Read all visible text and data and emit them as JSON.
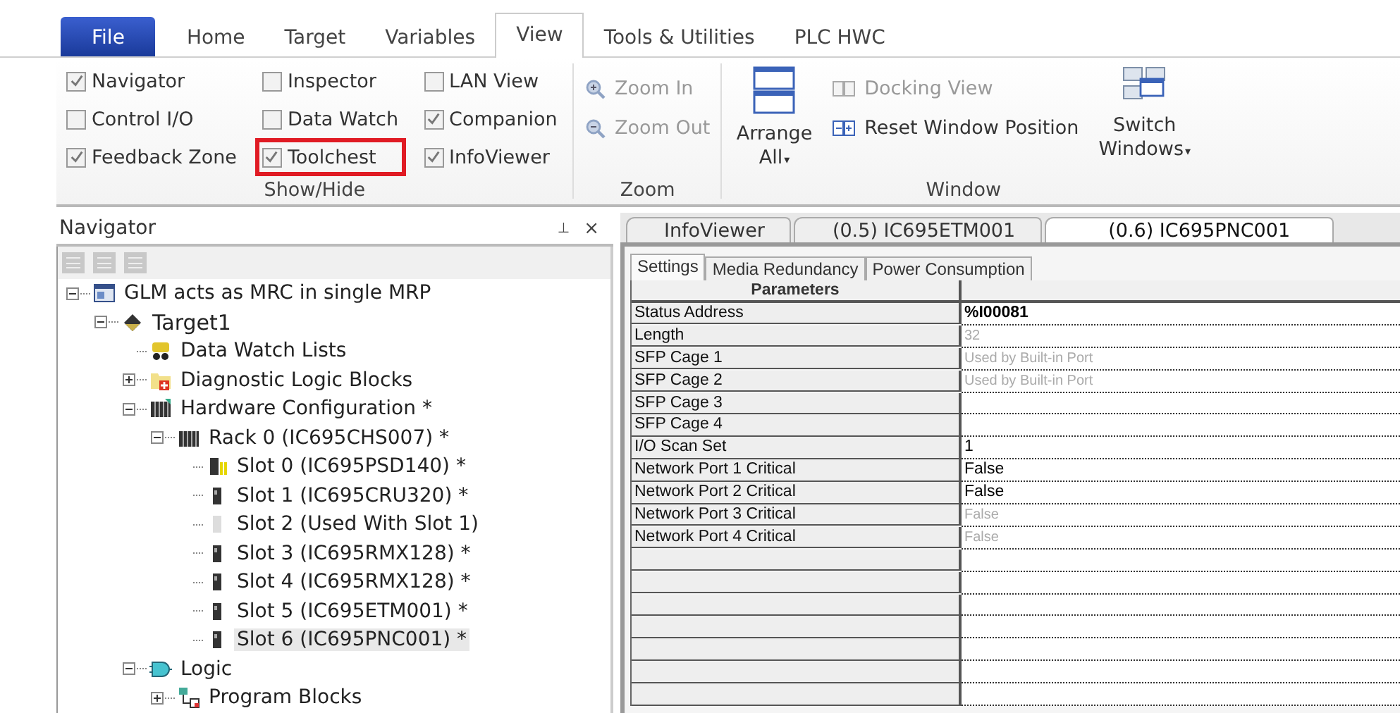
{
  "ribbon_tabs": [
    {
      "label": "File",
      "kind": "file",
      "selected": false
    },
    {
      "label": "Home",
      "kind": "tab",
      "selected": false
    },
    {
      "label": "Target",
      "kind": "tab",
      "selected": false
    },
    {
      "label": "Variables",
      "kind": "tab",
      "selected": false
    },
    {
      "label": "View",
      "kind": "tab",
      "selected": true
    },
    {
      "label": "Tools & Utilities",
      "kind": "tab",
      "selected": false
    },
    {
      "label": "PLC HWC",
      "kind": "tab",
      "selected": false
    }
  ],
  "show_hide": {
    "label": "Show/Hide",
    "columns": [
      [
        {
          "label": "Navigator",
          "checked": true,
          "highlighted": false
        },
        {
          "label": "Control I/O",
          "checked": false,
          "highlighted": false
        },
        {
          "label": "Feedback Zone",
          "checked": true,
          "highlighted": false
        }
      ],
      [
        {
          "label": "Inspector",
          "checked": false,
          "highlighted": false
        },
        {
          "label": "Data Watch",
          "checked": false,
          "highlighted": false
        },
        {
          "label": "Toolchest",
          "checked": true,
          "highlighted": true
        }
      ],
      [
        {
          "label": "LAN View",
          "checked": false,
          "highlighted": false
        },
        {
          "label": "Companion",
          "checked": true,
          "highlighted": false
        },
        {
          "label": "InfoViewer",
          "checked": true,
          "highlighted": false
        }
      ]
    ]
  },
  "zoom": {
    "label": "Zoom",
    "items": [
      {
        "label": "Zoom In",
        "kind": "zoom-in",
        "disabled": true
      },
      {
        "label": "Zoom Out",
        "kind": "zoom-out",
        "disabled": true
      }
    ]
  },
  "window_group": {
    "label": "Window",
    "arrange": {
      "line1": "Arrange",
      "line2": "All",
      "caret": "▾"
    },
    "items": [
      {
        "label": "Docking View",
        "kind": "docking",
        "disabled": true
      },
      {
        "label": "Reset Window Position",
        "kind": "reset",
        "disabled": false
      }
    ],
    "switch": {
      "line1": "Switch",
      "line2": "Windows",
      "caret": "▾"
    }
  },
  "navigator": {
    "title": "Navigator",
    "pin": "⊥",
    "close": "×",
    "tree": [
      {
        "label": "GLM acts as MRC in single MRP",
        "kind": "project",
        "expanded": true,
        "selected": false,
        "children": [
          {
            "label": "Target1",
            "kind": "target",
            "expanded": true,
            "selected": false,
            "children": [
              {
                "label": "Data Watch Lists",
                "kind": "watch",
                "selected": false
              },
              {
                "label": "Diagnostic Logic Blocks",
                "kind": "diag",
                "expanded": false,
                "selected": false
              },
              {
                "label": "Hardware Configuration *",
                "kind": "hardware",
                "expanded": true,
                "selected": false,
                "children": [
                  {
                    "label": "Rack 0 (IC695CHS007) *",
                    "kind": "rack",
                    "expanded": true,
                    "selected": false,
                    "children": [
                      {
                        "label": "Slot 0 (IC695PSD140) *",
                        "kind": "psu",
                        "selected": false
                      },
                      {
                        "label": "Slot 1 (IC695CRU320) *",
                        "kind": "module",
                        "selected": false
                      },
                      {
                        "label": "Slot 2 (Used With Slot 1)",
                        "kind": "module-faint",
                        "selected": false
                      },
                      {
                        "label": "Slot 3 (IC695RMX128) *",
                        "kind": "module",
                        "selected": false
                      },
                      {
                        "label": "Slot 4 (IC695RMX128) *",
                        "kind": "module",
                        "selected": false
                      },
                      {
                        "label": "Slot 5 (IC695ETM001) *",
                        "kind": "module",
                        "selected": false
                      },
                      {
                        "label": "Slot 6 (IC695PNC001) *",
                        "kind": "module",
                        "selected": true
                      }
                    ]
                  }
                ]
              },
              {
                "label": "Logic",
                "kind": "logic",
                "expanded": true,
                "selected": false,
                "children": [
                  {
                    "label": "Program Blocks",
                    "kind": "program",
                    "expanded": false,
                    "selected": false
                  }
                ]
              }
            ]
          }
        ]
      }
    ]
  },
  "doc_tabs": [
    {
      "label": "InfoViewer",
      "selected": false
    },
    {
      "label": "(0.5) IC695ETM001",
      "selected": false
    },
    {
      "label": "(0.6) IC695PNC001",
      "selected": true
    }
  ],
  "sub_tabs": [
    {
      "label": "Settings",
      "selected": true
    },
    {
      "label": "Media Redundancy",
      "selected": false
    },
    {
      "label": "Power Consumption",
      "selected": false
    }
  ],
  "table": {
    "header": "Parameters",
    "rows": [
      {
        "name": "Status Address",
        "value": "%I00081",
        "kind": "address",
        "disabled": false
      },
      {
        "name": "Length",
        "value": "32",
        "kind": "text",
        "disabled": true
      },
      {
        "name": "SFP Cage 1",
        "value": "Used by Built-in Port",
        "kind": "text",
        "disabled": true
      },
      {
        "name": "SFP Cage 2",
        "value": "Used by Built-in Port",
        "kind": "text",
        "disabled": true
      },
      {
        "name": "SFP Cage 3"
      },
      {
        "name": "SFP Cage 4"
      },
      {
        "name": "I/O Scan Set",
        "value": "1",
        "kind": "text",
        "disabled": false
      },
      {
        "name": "Network Port 1 Critical",
        "value": "False",
        "kind": "text",
        "disabled": false
      },
      {
        "name": "Network Port 2 Critical",
        "value": "False",
        "kind": "text",
        "disabled": false
      },
      {
        "name": "Network Port 3 Critical",
        "value": "False",
        "kind": "text",
        "disabled": true
      },
      {
        "name": "Network Port 4 Critical",
        "value": "False",
        "kind": "text",
        "disabled": true
      }
    ]
  }
}
